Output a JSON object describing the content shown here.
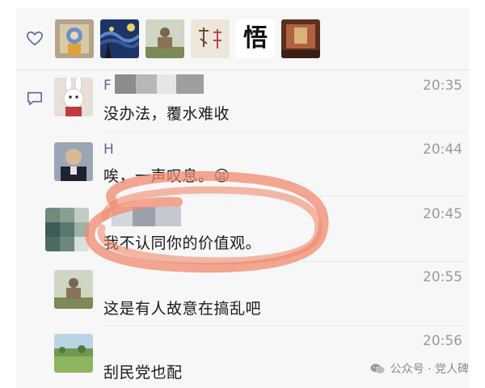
{
  "colors": {
    "name": "#576b95",
    "time": "#9a9a9a",
    "text": "#1a1a1a",
    "highlight": "#f08a6e"
  },
  "likes": {
    "icon": "heart-outline-icon",
    "avatars": [
      "avatar-cartoon-figure",
      "avatar-starry-night",
      "avatar-statue",
      "avatar-calligraphy-a",
      "avatar-calligraphy-wu",
      "avatar-traditional-room"
    ],
    "wu_char": "悟"
  },
  "comments_icon": "comment-bubble-icon",
  "comments": [
    {
      "name": "F",
      "time": "20:35",
      "text": "没办法，覆水难收",
      "avatar": "avatar-rabbit"
    },
    {
      "name": "H",
      "time": "20:44",
      "text": "唉，一声叹息。😫",
      "avatar": "avatar-officer"
    },
    {
      "name": "",
      "time": "20:45",
      "text": "我不认同你的价值观。",
      "avatar": "avatar-blurred"
    },
    {
      "name": "",
      "time": "20:55",
      "text": "这是有人故意在搞乱吧",
      "avatar": "avatar-statue"
    },
    {
      "name": "",
      "time": "20:56",
      "text": "刮民党也配",
      "avatar": "avatar-landscape"
    }
  ],
  "watermark": {
    "text": "公众号 · 党人碑",
    "icon": "wechat-icon"
  }
}
